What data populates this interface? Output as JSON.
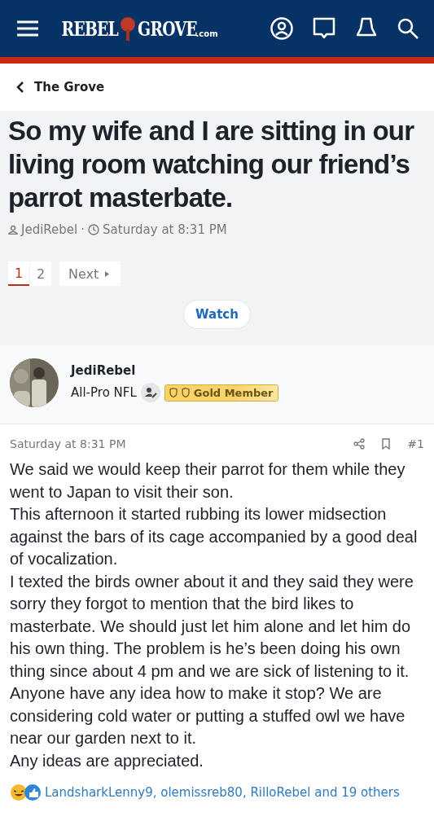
{
  "header": {
    "logo_left": "REBEL",
    "logo_right": "GROVE",
    ".com": ".com"
  },
  "breadcrumb": {
    "label": "The Grove"
  },
  "thread": {
    "title": "So my wife and I are sitting in our living room watching our friend’s parrot masterbate.",
    "author": "JediRebel",
    "separator": "·",
    "date": "Saturday at 8:31 PM"
  },
  "pagination": {
    "pages": [
      {
        "label": "1",
        "selected": true
      },
      {
        "label": "2",
        "selected": false
      }
    ],
    "next": "Next"
  },
  "watch_button": "Watch",
  "post": {
    "author": "JediRebel",
    "title": "All-Pro NFL",
    "badge": "Gold Member",
    "date": "Saturday at 8:31 PM",
    "number": "#1",
    "paragraphs": [
      "We said we would keep their parrot for them while they went to Japan to visit their son.",
      "This afternoon it started rubbing its lower midsection against the bars of its cage accompanied by a good deal of vocalization.",
      "I texted the birds owner about it and they said they were sorry they forgot to mention that the bird likes to masterbate. We should just let him alone and let him do his own thing. The problem is he’s been doing his own thing since about 4 pm and we are sick of listening to it.",
      "Anyone have any idea how to make it stop? We are considering cold water or putting a stuffed owl we have near our garden next to it.",
      "Any ideas are appreciated."
    ],
    "reactions": "LandsharkLenny9, olemissreb80, RilloRebel and 19 others"
  }
}
